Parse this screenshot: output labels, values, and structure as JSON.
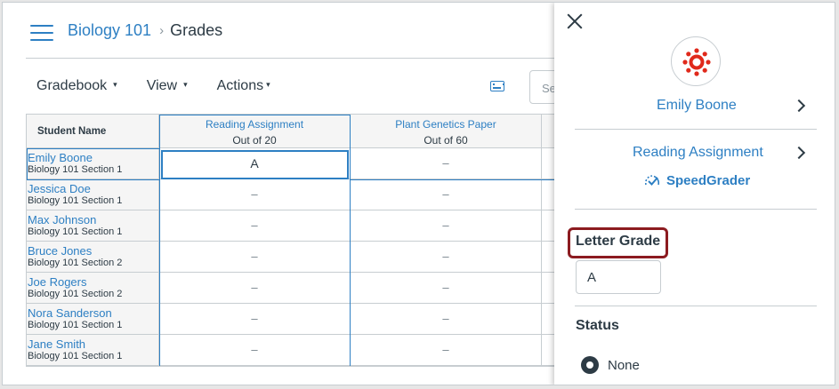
{
  "breadcrumb": {
    "course": "Biology 101",
    "separator": "›",
    "current": "Grades"
  },
  "toolbar": {
    "menus": [
      {
        "label": "Gradebook",
        "caret": "▾"
      },
      {
        "label": "View",
        "caret": "▾"
      },
      {
        "label": "Actions",
        "caret": "▾"
      }
    ],
    "search_placeholder": "Se"
  },
  "grid": {
    "name_header": "Student Name",
    "assignments": [
      {
        "title": "Reading Assignment",
        "sub": "Out of 20"
      },
      {
        "title": "Plant Genetics Paper",
        "sub": "Out of 60"
      }
    ],
    "students": [
      {
        "name": "Emily Boone",
        "section": "Biology 101 Section 1",
        "grades": [
          "A",
          "–"
        ]
      },
      {
        "name": "Jessica Doe",
        "section": "Biology 101 Section 1",
        "grades": [
          "–",
          "–"
        ]
      },
      {
        "name": "Max Johnson",
        "section": "Biology 101 Section 1",
        "grades": [
          "–",
          "–"
        ]
      },
      {
        "name": "Bruce Jones",
        "section": "Biology 101 Section 2",
        "grades": [
          "–",
          "–"
        ]
      },
      {
        "name": "Joe Rogers",
        "section": "Biology 101 Section 2",
        "grades": [
          "–",
          "–"
        ]
      },
      {
        "name": "Nora Sanderson",
        "section": "Biology 101 Section 1",
        "grades": [
          "–",
          "–"
        ]
      },
      {
        "name": "Jane Smith",
        "section": "Biology 101 Section 1",
        "grades": [
          "–",
          "–"
        ]
      }
    ]
  },
  "tray": {
    "student_name": "Emily Boone",
    "assignment_name": "Reading Assignment",
    "speedgrader_label": "SpeedGrader",
    "letter_grade_label": "Letter Grade",
    "letter_grade_value": "A",
    "status_label": "Status",
    "status_option": "None"
  },
  "colors": {
    "link": "#2d7fc3",
    "text": "#2d3b45",
    "border": "#c7cdd1",
    "highlight": "#8c1b20",
    "brand_red": "#e0291b"
  }
}
